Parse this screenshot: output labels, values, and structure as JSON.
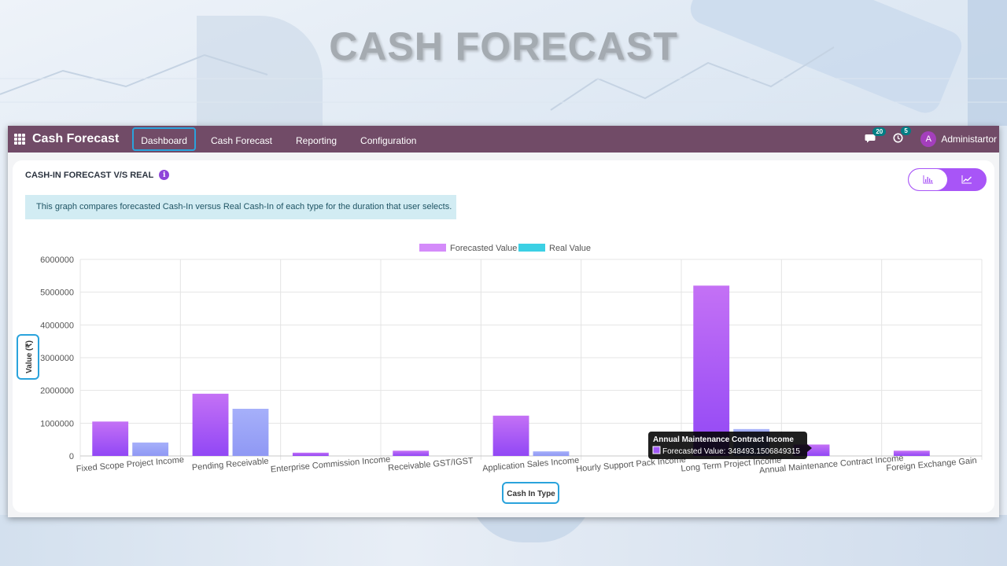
{
  "page": {
    "banner_title": "CASH FORECAST"
  },
  "navbar": {
    "brand": "Cash Forecast",
    "menu": [
      "Dashboard",
      "Cash Forecast",
      "Reporting",
      "Configuration"
    ],
    "active_index": 0,
    "messages_badge": "20",
    "activities_badge": "5",
    "user_initial": "A",
    "user_name": "Administartor",
    "color": "#714b67"
  },
  "card": {
    "title": "CASH-IN FORECAST V/S REAL",
    "info_text": "This graph compares forecasted Cash-In versus Real Cash-In of each type for the duration that user selects.",
    "view_toggle": [
      "bar-chart-icon",
      "line-chart-icon"
    ],
    "active_view": "bar"
  },
  "chart_data": {
    "type": "bar",
    "xlabel": "Cash In Type",
    "ylabel": "Value (₹)",
    "ylim": [
      0,
      6000000
    ],
    "yticks": [
      0,
      1000000,
      2000000,
      3000000,
      4000000,
      5000000,
      6000000
    ],
    "grid": true,
    "legend_position": "top-center",
    "categories": [
      "Fixed Scope Project Income",
      "Pending Receivable",
      "Enterprise Commission Income",
      "Receivable GST/IGST",
      "Application Sales Income",
      "Hourly Support Pack Income",
      "Long Term Project Income",
      "Annual Maintenance Contract Income",
      "Foreign Exchange Gain"
    ],
    "series": [
      {
        "name": "Forecasted Value",
        "color": "#a259f7",
        "values": [
          1050000,
          1900000,
          100000,
          160000,
          1230000,
          0,
          5200000,
          348493.15,
          160000
        ]
      },
      {
        "name": "Real Value",
        "color": "#9ca6f8",
        "values": [
          410000,
          1440000,
          0,
          0,
          140000,
          0,
          820000,
          0,
          0
        ]
      }
    ],
    "legend_colors": [
      "#d48bfa",
      "#3cd0e4"
    ],
    "tooltip": {
      "title": "Annual Maintenance Contract Income",
      "label": "Forecasted Value: 348493.1506849315"
    }
  }
}
